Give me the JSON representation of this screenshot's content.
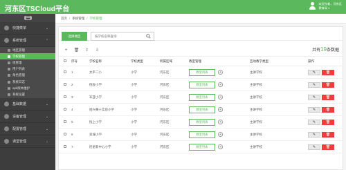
{
  "app": {
    "title": "河东区TSCloud平台"
  },
  "user": {
    "line1": "欢迎光临，河东区",
    "line2": "教育局 ▾"
  },
  "sidebar": {
    "groups": [
      {
        "label": "快捷菜单",
        "chev": "⌄"
      },
      {
        "label": "系统管理",
        "chev": "⌃"
      },
      {
        "label": "基础数据",
        "chev": "⌄"
      },
      {
        "label": "设备管理",
        "chev": "⌄"
      },
      {
        "label": "配置管理",
        "chev": "⌄"
      },
      {
        "label": "课堂管理",
        "chev": "⌄"
      }
    ],
    "sub_items": [
      "地区管理",
      "学校管理",
      "组管理",
      "用户列表",
      "角色管理",
      "系统日志",
      "apk版本维护",
      "系统设置"
    ]
  },
  "breadcrumb": {
    "items": [
      "首页",
      "系统管理",
      "学校管理"
    ],
    "sep": "/"
  },
  "toolbar": {
    "select_area_label": "选择地区",
    "search_placeholder": "按学校名称查询",
    "add_icon": "+",
    "delete_icon": "🗑",
    "upload_icon": "⇪",
    "download_icon": "⇩",
    "count_prefix": "共有",
    "count_value": "19",
    "count_suffix": "条数据"
  },
  "table": {
    "headers": [
      "序号",
      "学校名称",
      "学校类型",
      "所属区域",
      "教室管理",
      "互动教学类型",
      "操作"
    ],
    "edu_button_label": "教室列表",
    "plus_label": "+",
    "edit_icon": "✎",
    "delete_icon": "🗑",
    "rows": [
      {
        "index": "1",
        "name": "太平二小",
        "type": "小学",
        "area": "河东区",
        "teach": "主讲学校"
      },
      {
        "index": "2",
        "name": "倪会小学",
        "type": "小学",
        "area": "河东区",
        "teach": "主讲学校"
      },
      {
        "index": "3",
        "name": "军亚小学",
        "type": "小学",
        "area": "河东区",
        "teach": "主讲学校"
      },
      {
        "index": "4",
        "name": "绍兴黄十实验小学",
        "type": "小学",
        "area": "河东区",
        "teach": "主讲学校"
      },
      {
        "index": "5",
        "name": "恍上小学",
        "type": "小学",
        "area": "河东区",
        "teach": "主讲学校"
      },
      {
        "index": "6",
        "name": "双城小学",
        "type": "小学",
        "area": "河东区",
        "teach": "主讲学校"
      },
      {
        "index": "7",
        "name": "民星新中心小学",
        "type": "小学",
        "area": "河东区",
        "teach": "主讲学校"
      }
    ]
  },
  "colors": {
    "accent": "#5cb85c",
    "sidebar": "#3d3d3d",
    "danger": "#ef3c3c"
  }
}
